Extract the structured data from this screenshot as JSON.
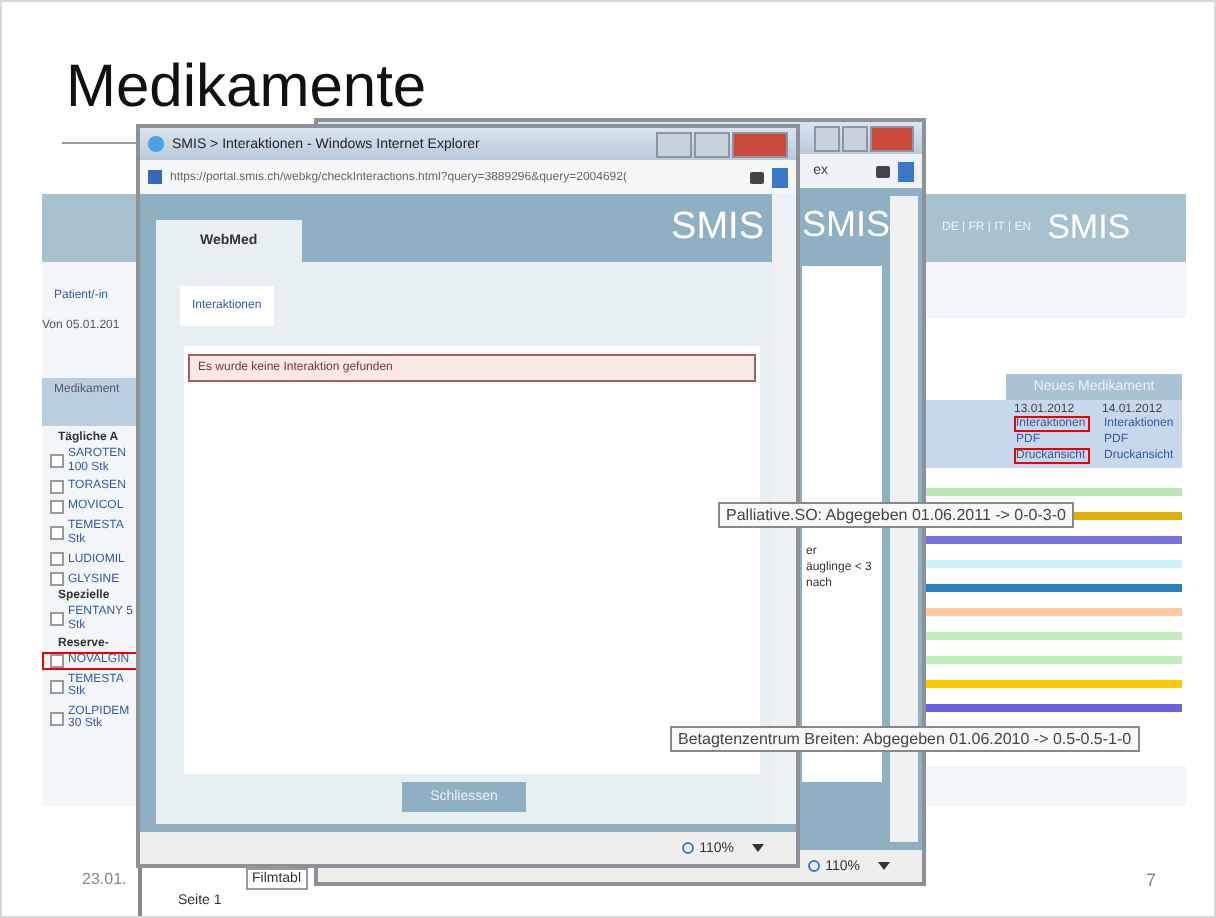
{
  "slide": {
    "title": "Medikamente",
    "date": "23.01.",
    "page_number": "7"
  },
  "background_app": {
    "languages": "DE | FR | IT | EN",
    "logo": "SMIS",
    "patient_link": "Patient/-in",
    "date_range": "Von 05.01.201",
    "column_heading": "Medikament",
    "med_groups": [
      {
        "label": "Tägliche A",
        "items": [
          {
            "name": "SAROTEN 100 Stk",
            "checked": false,
            "highlighted": false
          },
          {
            "name": "TORASEN",
            "checked": false,
            "highlighted": false
          },
          {
            "name": "MOVICOL",
            "checked": false,
            "highlighted": false
          },
          {
            "name": "TEMESTA Stk",
            "checked": false,
            "highlighted": false
          },
          {
            "name": "LUDIOMIL",
            "checked": false,
            "highlighted": false
          },
          {
            "name": "GLYSINE",
            "checked": false,
            "highlighted": false
          }
        ]
      },
      {
        "label": "Spezielle",
        "items": [
          {
            "name": "FENTANY 5 Stk",
            "checked": false,
            "highlighted": false
          }
        ]
      },
      {
        "label": "Reserve-",
        "items": [
          {
            "name": "NOVALGIN",
            "checked": false,
            "highlighted": true
          },
          {
            "name": "TEMESTA Stk",
            "checked": false,
            "highlighted": false
          },
          {
            "name": "ZOLPIDEM 30 Stk",
            "checked": false,
            "highlighted": false
          }
        ]
      }
    ],
    "table_header": "Neues Medikament",
    "columns": [
      {
        "date": "13.01.2012",
        "links": [
          {
            "text": "Interaktionen",
            "highlighted": true
          },
          {
            "text": "PDF",
            "highlighted": false
          },
          {
            "text": "Druckansicht",
            "highlighted": true
          }
        ]
      },
      {
        "date": "14.01.2012",
        "links": [
          {
            "text": "Interaktionen",
            "highlighted": false
          },
          {
            "text": "PDF",
            "highlighted": false
          },
          {
            "text": "Druckansicht",
            "highlighted": false
          }
        ]
      }
    ],
    "timeline_bars": [
      {
        "color": "#b8e8b0"
      },
      {
        "color": "#e0b000"
      },
      {
        "color": "#7a70e0"
      },
      {
        "color": "#c8f4f8"
      },
      {
        "color": "#2a80c0"
      },
      {
        "color": "#ffc8a0"
      },
      {
        "color": "#c0f0b8"
      },
      {
        "color": "#c0f0b8"
      },
      {
        "color": "#ffc800"
      },
      {
        "color": "#6a60e0"
      }
    ]
  },
  "middle_window": {
    "address": "ex",
    "logo": "SMIS",
    "text_lines": [
      "er",
      "äuglinge < 3",
      "nach"
    ],
    "zoom": "110%"
  },
  "front_window": {
    "title": "SMIS > Interaktionen - Windows Internet Explorer",
    "url": "https://portal.smis.ch/webkg/checkInteractions.html?query=3889296&query=2004692(",
    "tab": "WebMed",
    "logo": "SMIS",
    "section_button": "Interaktionen",
    "message": "Es wurde keine Interaktion gefunden",
    "close_button": "Schliessen",
    "zoom": "110%"
  },
  "tooltips": [
    {
      "text": "Palliative.SO: Abgegeben 01.06.2011 -> 0-0-3-0",
      "kind": "upper"
    },
    {
      "text": "Betagtenzentrum Breiten: Abgegeben 01.06.2010 -> 0.5-0.5-1-0",
      "kind": "lower"
    }
  ],
  "bottom_strip": {
    "tab": "Filmtabl",
    "page_label": "Seite 1"
  }
}
